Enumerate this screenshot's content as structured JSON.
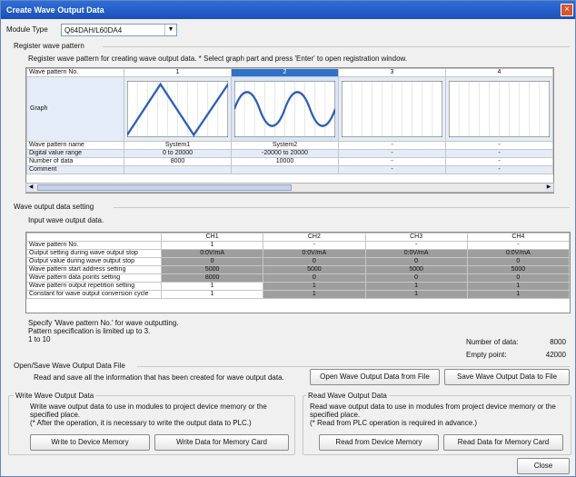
{
  "window": {
    "title": "Create Wave Output Data"
  },
  "module_type": {
    "label": "Module Type",
    "value": "Q64DAH/L60DA4"
  },
  "register": {
    "section_title": "Register wave pattern",
    "instruction": "Register wave pattern for creating wave output data. * Select graph part and press 'Enter' to open registration window.",
    "header_label": "Wave pattern No.",
    "columns": [
      "1",
      "2",
      "3",
      "4"
    ],
    "rows": [
      {
        "label": "Wave pattern name",
        "values": [
          "System1",
          "System2",
          "-",
          "-"
        ]
      },
      {
        "label": "Digital value range",
        "values": [
          "0 to 20000",
          "-20000 to 20000",
          "-",
          "-"
        ]
      },
      {
        "label": "Number of data",
        "values": [
          "8000",
          "10000",
          "-",
          "-"
        ]
      },
      {
        "label": "Comment",
        "values": [
          "",
          "",
          "-",
          "-"
        ]
      }
    ],
    "graph_label": "Graph"
  },
  "output_setting": {
    "section_title": "Wave output data setting",
    "instruction": "Input wave output data.",
    "channels": [
      "CH1",
      "CH2",
      "CH3",
      "CH4"
    ],
    "rows": [
      {
        "label": "Wave pattern No.",
        "values": [
          "1",
          "-",
          "-",
          "-"
        ]
      },
      {
        "label": "Output setting during wave output stop",
        "values": [
          "0:0V/mA",
          "0:0V/mA",
          "0:0V/mA",
          "0:0V/mA"
        ]
      },
      {
        "label": "Output value during wave output stop",
        "values": [
          "0",
          "0",
          "0",
          "0"
        ]
      },
      {
        "label": "Wave pattern start address setting",
        "values": [
          "5000",
          "5000",
          "5000",
          "5000"
        ]
      },
      {
        "label": "Wave pattern data points setting",
        "values": [
          "8000",
          "0",
          "0",
          "0"
        ]
      },
      {
        "label": "Wave pattern output repetition setting",
        "values": [
          "1",
          "1",
          "1",
          "1"
        ]
      },
      {
        "label": "Constant for wave output conversion cycle",
        "values": [
          "1",
          "1",
          "1",
          "1"
        ]
      }
    ],
    "note_lines": [
      "Specify 'Wave pattern No.' for wave outputting.",
      "Pattern specification is limited up to 3.",
      "1 to 10"
    ],
    "number_of_data_label": "Number of data:",
    "number_of_data_value": "8000",
    "empty_point_label": "Empty point:",
    "empty_point_value": "42000"
  },
  "open_save": {
    "section_title": "Open/Save Wave Output Data File",
    "description": "Read and save all the information that has been created for wave output data.",
    "open_button": "Open Wave Output Data from File",
    "save_button": "Save Wave Output Data to File"
  },
  "write_group": {
    "title": "Write Wave Output Data",
    "desc1": "Write wave output data to use in modules to project device memory or the",
    "desc2": "specified place.",
    "desc3": "(* After the operation, it is necessary to write the output data to PLC.)",
    "btn_device": "Write to Device Memory",
    "btn_card": "Write Data for Memory Card"
  },
  "read_group": {
    "title": "Read Wave Output Data",
    "desc1": "Read wave output data to use in modules from project device memory or the",
    "desc2": "specified place.",
    "desc3": "(* Read from PLC operation is required in advance.)",
    "btn_device": "Read from Device Memory",
    "btn_card": "Read Data for Memory Card"
  },
  "close_button": "Close",
  "colors": {
    "selected_header": "#2e72c9",
    "graph_line": "#2b5fb8",
    "disabled_cell": "#9e9e9e"
  }
}
